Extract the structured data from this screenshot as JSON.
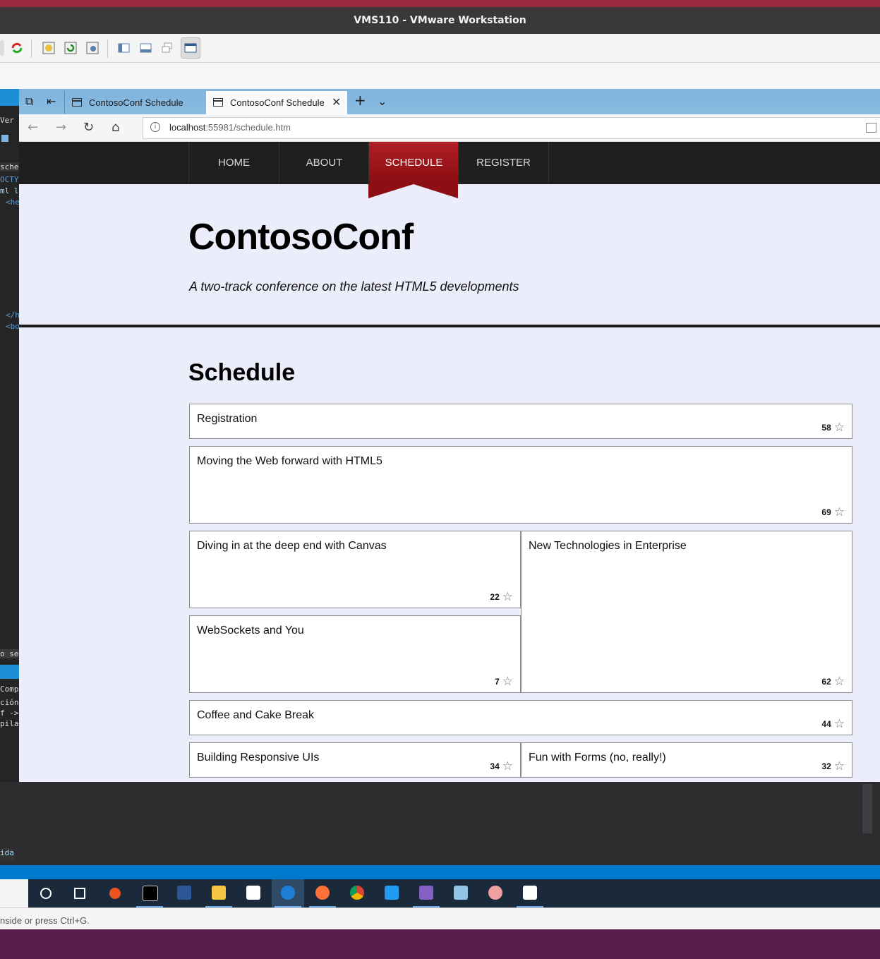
{
  "vmware": {
    "title": "VMS110 - VMware Workstation",
    "status_text": "nside or press Ctrl+G."
  },
  "code_editor": {
    "lines": [
      "Ver",
      "sched",
      "OCTY",
      "ml l",
      "<he",
      "</h",
      "<bo",
      "o se e",
      "Comp",
      "ción",
      "f ->",
      "pila",
      "ida"
    ]
  },
  "browser": {
    "tabs": [
      {
        "label": "ContosoConf Schedule",
        "active": false
      },
      {
        "label": "ContosoConf Schedule",
        "active": true
      }
    ],
    "url_host": "localhost",
    "url_rest": ":55981/schedule.htm"
  },
  "site": {
    "nav": [
      "HOME",
      "ABOUT",
      "SCHEDULE",
      "REGISTER"
    ],
    "active_nav": "SCHEDULE",
    "title": "ContosoConf",
    "tagline": "A two-track conference on the latest HTML5 developments",
    "schedule_heading": "Schedule",
    "sessions": [
      {
        "title": "Registration",
        "rating": "58"
      },
      {
        "title": "Moving the Web forward with HTML5",
        "rating": "69"
      },
      {
        "title": "Diving in at the deep end with Canvas",
        "rating": "22"
      },
      {
        "title": "New Technologies in Enterprise",
        "rating": "62"
      },
      {
        "title": "WebSockets and You",
        "rating": "7"
      },
      {
        "title": "Coffee and Cake Break",
        "rating": "44"
      },
      {
        "title": "Building Responsive UIs",
        "rating": "34"
      },
      {
        "title": "Fun with Forms (no, really!)",
        "rating": "32"
      }
    ]
  },
  "taskbar": {
    "apps": [
      "search-circle-icon",
      "task-view-icon",
      "ubuntu-icon",
      "terminal-icon",
      "powershell-icon",
      "file-explorer-icon",
      "store-icon",
      "edge-icon",
      "firefox-icon",
      "chrome-icon",
      "vscode-icon",
      "visual-studio-icon",
      "notepad-icon",
      "paint-icon",
      "text-editor-icon"
    ]
  },
  "colors": {
    "nav_active": "#9b1418",
    "page_bg": "#ebedfa",
    "nav_bg": "#1f1f1f"
  }
}
